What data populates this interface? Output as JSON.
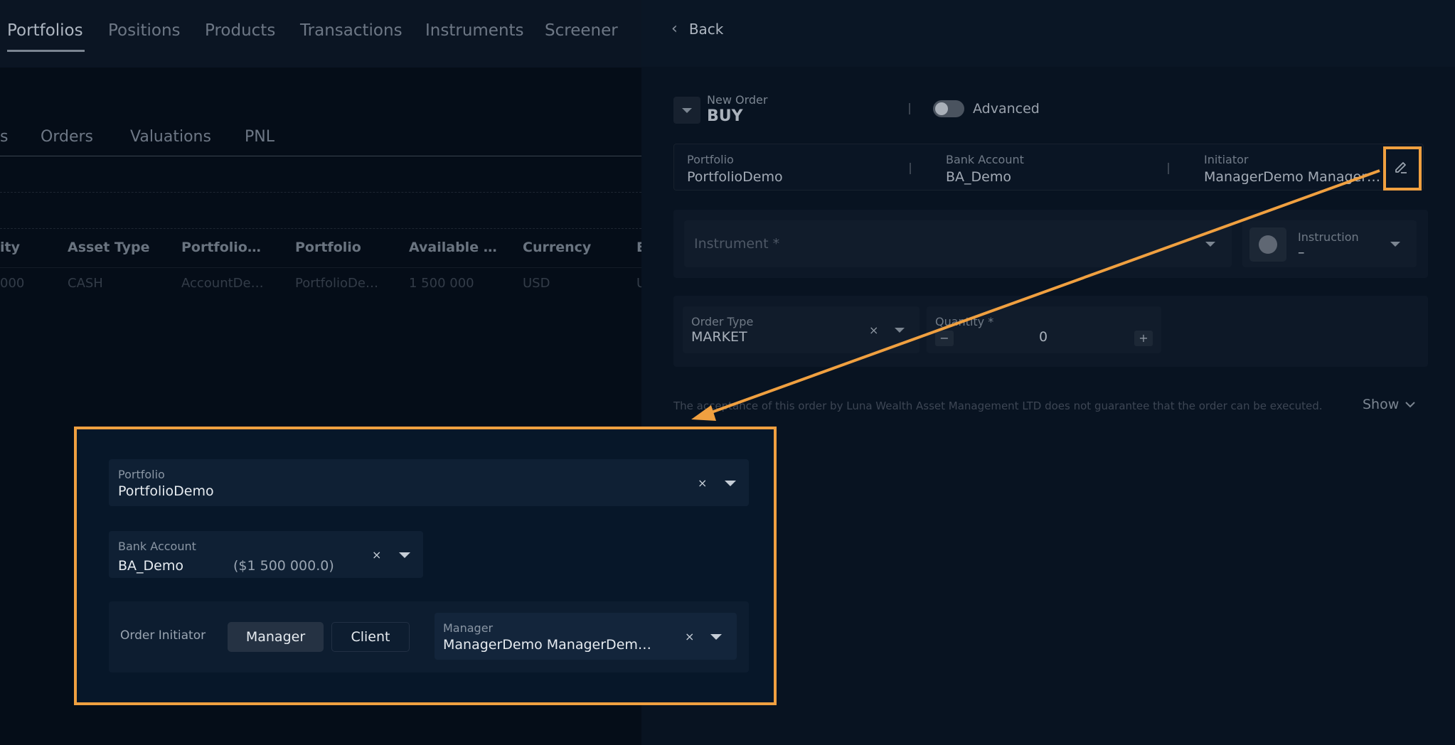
{
  "nav": {
    "tabs": [
      "Portfolios",
      "Positions",
      "Products",
      "Transactions",
      "Instruments",
      "Screener"
    ],
    "active": "Portfolios"
  },
  "subtabs": [
    "s",
    "Orders",
    "Valuations",
    "PNL"
  ],
  "table": {
    "headers": [
      "ity",
      "Asset Type",
      "Portfolio…",
      "Portfolio",
      "Available …",
      "Currency",
      "E"
    ],
    "row": [
      "000",
      "CASH",
      "AccountDe…",
      "PortfolioDe…",
      "1 500 000",
      "USD",
      "U"
    ]
  },
  "panel": {
    "back_label": "Back",
    "new_order_label": "New Order",
    "side": "BUY",
    "advanced_label": "Advanced",
    "advanced_on": false,
    "summary": {
      "portfolio_label": "Portfolio",
      "portfolio_value": "PortfolioDemo",
      "bank_label": "Bank Account",
      "bank_value": "BA_Demo",
      "initiator_label": "Initiator",
      "initiator_value": "ManagerDemo Manager…"
    },
    "instrument_placeholder": "Instrument *",
    "instruction_label": "Instruction",
    "instruction_value": "–",
    "order_type_label": "Order Type",
    "order_type_value": "MARKET",
    "quantity_label": "Quantity *",
    "quantity_value": "0",
    "disclaimer": "The acceptance of this order by Luna Wealth Asset Management LTD does not guarantee that the order can be executed.",
    "show_label": "Show"
  },
  "callout": {
    "portfolio_label": "Portfolio",
    "portfolio_value": "PortfolioDemo",
    "bank_label": "Bank Account",
    "bank_value": "BA_Demo",
    "bank_balance": "($1 500 000.0)",
    "initiator_label": "Order Initiator",
    "manager_option": "Manager",
    "client_option": "Client",
    "manager_label": "Manager",
    "manager_value": "ManagerDemo ManagerDem…"
  },
  "colors": {
    "accent": "#f0a040",
    "background": "#050d18",
    "panel": "#081321"
  },
  "icons": {
    "back": "chevron-left-icon",
    "edit": "pencil-icon",
    "dropdown": "caret-down-icon",
    "clear": "close-icon",
    "show": "chevron-down-icon"
  }
}
